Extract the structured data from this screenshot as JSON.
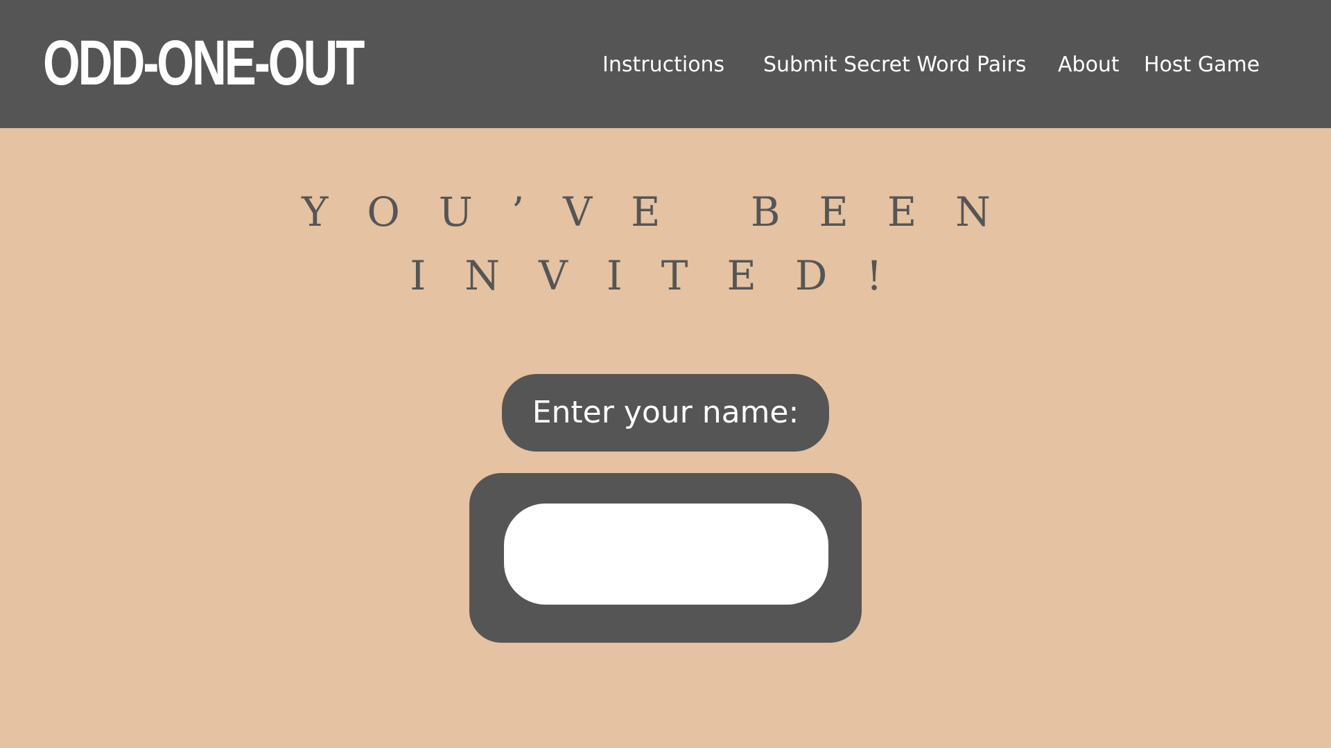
{
  "colors": {
    "background": "#e4c2a2",
    "header": "#555555",
    "text_light": "#ffffff",
    "text_dark": "#555555"
  },
  "header": {
    "logo": "ODD-ONE-OUT",
    "nav": [
      {
        "label": "Instructions"
      },
      {
        "label": "Submit Secret Word Pairs"
      },
      {
        "label": "About"
      },
      {
        "label": "Host Game"
      }
    ]
  },
  "main": {
    "headline_line1": "YOU’VE BEEN",
    "headline_line2": "INVITED!",
    "name_prompt": "Enter your name:",
    "name_input": {
      "value": "",
      "placeholder": ""
    }
  }
}
